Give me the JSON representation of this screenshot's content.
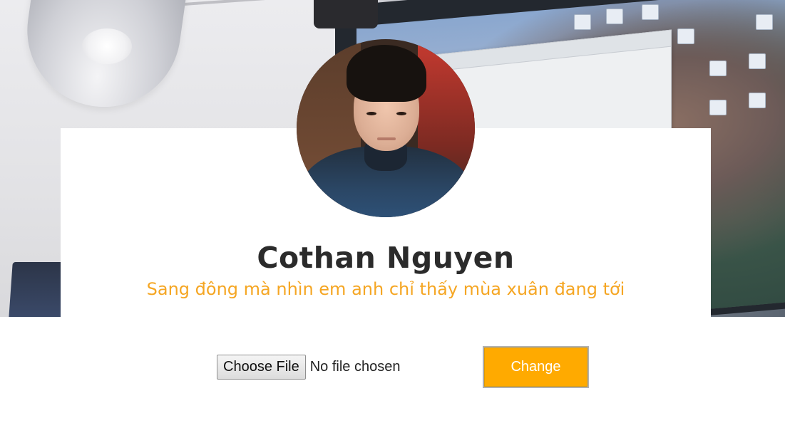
{
  "profile": {
    "name": "Cothan Nguyen",
    "tagline": "Sang đông mà nhìn em anh chỉ thấy mùa xuân đang tới"
  },
  "upload": {
    "choose_file_label": "Choose File",
    "file_status": "No file chosen",
    "change_label": "Change"
  },
  "colors": {
    "accent": "#ffaa00",
    "tagline": "#f5a623",
    "name": "#2b2b2b"
  }
}
